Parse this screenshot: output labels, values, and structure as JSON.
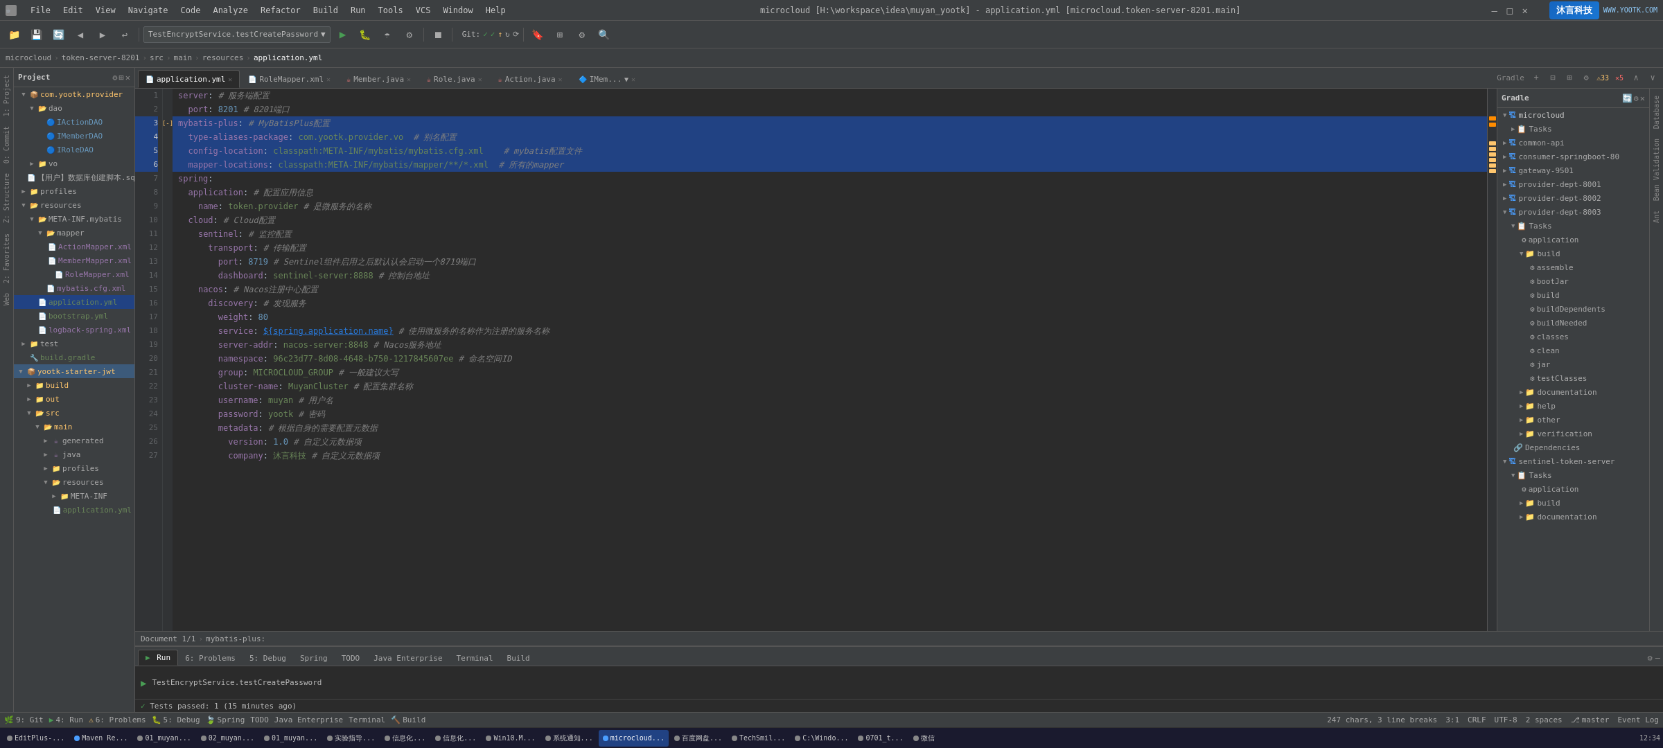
{
  "titlebar": {
    "icon": "☕",
    "menu_items": [
      "File",
      "Edit",
      "View",
      "Navigate",
      "Code",
      "Analyze",
      "Refactor",
      "Build",
      "Run",
      "Tools",
      "VCS",
      "Window",
      "Help"
    ],
    "title": "microcloud [H:\\workspace\\idea\\muyan_yootk] - application.yml [microcloud.token-server-8201.main]",
    "close": "✕",
    "minimize": "—",
    "maximize": "□"
  },
  "toolbar": {
    "combo_label": "TestEncryptService.testCreatePassword",
    "run": "▶",
    "debug": "🐛",
    "git_label": "Git:",
    "search_icon": "🔍"
  },
  "breadcrumb": {
    "items": [
      "microcloud",
      "token-server-8201",
      "src",
      "main",
      "resources",
      "application.yml"
    ]
  },
  "tabs": {
    "items": [
      {
        "id": "application-yml",
        "label": "application.yml",
        "active": true,
        "icon": "yml",
        "modified": false
      },
      {
        "id": "role-mapper-xml",
        "label": "RoleMapper.xml",
        "active": false,
        "icon": "xml"
      },
      {
        "id": "member-java",
        "label": "Member.java",
        "active": false,
        "icon": "java"
      },
      {
        "id": "role-java",
        "label": "Role.java",
        "active": false,
        "icon": "java"
      },
      {
        "id": "action-java",
        "label": "Action.java",
        "active": false,
        "icon": "java"
      },
      {
        "id": "imemb",
        "label": "IMem...",
        "active": false,
        "icon": "iface"
      }
    ],
    "more": "▼"
  },
  "editor": {
    "lines": [
      {
        "num": 1,
        "content": "server: # 服务端配置",
        "type": "normal"
      },
      {
        "num": 2,
        "content": "  port: 8201 # 8201端口",
        "type": "normal"
      },
      {
        "num": 3,
        "content": "mybatis-plus: # MyBatisPlus配置",
        "type": "highlight"
      },
      {
        "num": 4,
        "content": "  type-aliases-package: com.yootk.provider.vo  # 别名配置",
        "type": "highlight"
      },
      {
        "num": 5,
        "content": "  config-location: classpath:META-INF/mybatis/mybatis.cfg.xml    # mybatis配置文件",
        "type": "highlight"
      },
      {
        "num": 6,
        "content": "  mapper-locations: classpath:META-INF/mybatis/mapper/**/*.xml  # 所有的mapper",
        "type": "highlight"
      },
      {
        "num": 7,
        "content": "spring:",
        "type": "normal"
      },
      {
        "num": 8,
        "content": "  application: # 配置应用信息",
        "type": "normal"
      },
      {
        "num": 9,
        "content": "    name: token.provider # 是微服务的名称",
        "type": "normal"
      },
      {
        "num": 10,
        "content": "  cloud: # Cloud配置",
        "type": "normal"
      },
      {
        "num": 11,
        "content": "    sentinel: # 监控配置",
        "type": "normal"
      },
      {
        "num": 12,
        "content": "      transport: # 传输配置",
        "type": "normal"
      },
      {
        "num": 13,
        "content": "        port: 8719 # Sentinel组件启用之后默认认会启动一个8719端口",
        "type": "normal"
      },
      {
        "num": 14,
        "content": "        dashboard: sentinel-server:8888 # 控制台地址",
        "type": "normal"
      },
      {
        "num": 15,
        "content": "    nacos: # Nacos注册中心配置",
        "type": "normal"
      },
      {
        "num": 16,
        "content": "      discovery: # 发现服务",
        "type": "normal"
      },
      {
        "num": 17,
        "content": "        weight: 80",
        "type": "normal"
      },
      {
        "num": 18,
        "content": "        service: ${spring.application.name} # 使用微服务的名称作为注册的服务名称",
        "type": "normal"
      },
      {
        "num": 19,
        "content": "        server-addr: nacos-server:8848 # Nacos服务地址",
        "type": "normal"
      },
      {
        "num": 20,
        "content": "        namespace: 96c23d77-8d08-4648-b750-1217845607ee # 命名空间ID",
        "type": "normal"
      },
      {
        "num": 21,
        "content": "        group: MICROCLOUD_GROUP # 一般建议大写",
        "type": "normal"
      },
      {
        "num": 22,
        "content": "        cluster-name: MuyanCluster # 配置集群名称",
        "type": "normal"
      },
      {
        "num": 23,
        "content": "        username: muyan # 用户名",
        "type": "normal"
      },
      {
        "num": 24,
        "content": "        password: yootk # 密码",
        "type": "normal"
      },
      {
        "num": 25,
        "content": "        metadata: # 根据自身的需要配置元数据",
        "type": "normal"
      },
      {
        "num": 26,
        "content": "          version: 1.0 # 自定义元数据项",
        "type": "normal"
      },
      {
        "num": 27,
        "content": "          company: 沐言科技 # 自定义元数据项",
        "type": "normal"
      }
    ],
    "breadcrumb": {
      "doc": "Document 1/1",
      "path": "mybatis-plus:"
    }
  },
  "project_tree": {
    "header": "Project",
    "items": [
      {
        "level": 0,
        "label": "com.yootk.provider",
        "type": "package",
        "expanded": true
      },
      {
        "level": 1,
        "label": "dao",
        "type": "folder",
        "expanded": true
      },
      {
        "level": 2,
        "label": "IActionDAO",
        "type": "java"
      },
      {
        "level": 2,
        "label": "IMemberDAO",
        "type": "java"
      },
      {
        "level": 2,
        "label": "IRoleDAO",
        "type": "java"
      },
      {
        "level": 1,
        "label": "vo",
        "type": "folder",
        "expanded": false
      },
      {
        "level": 1,
        "label": "【用户】数据库创建脚本.sql",
        "type": "sql"
      },
      {
        "level": 0,
        "label": "profiles",
        "type": "folder",
        "expanded": false
      },
      {
        "level": 0,
        "label": "resources",
        "type": "folder",
        "expanded": true
      },
      {
        "level": 1,
        "label": "META-INF.mybatis",
        "type": "folder",
        "expanded": true
      },
      {
        "level": 2,
        "label": "mapper",
        "type": "folder",
        "expanded": true
      },
      {
        "level": 3,
        "label": "ActionMapper.xml",
        "type": "xml"
      },
      {
        "level": 3,
        "label": "MemberMapper.xml",
        "type": "xml"
      },
      {
        "level": 3,
        "label": "RoleMapper.xml",
        "type": "xml"
      },
      {
        "level": 2,
        "label": "mybatis.cfg.xml",
        "type": "xml"
      },
      {
        "level": 1,
        "label": "application.yml",
        "type": "yml",
        "selected": true
      },
      {
        "level": 1,
        "label": "bootstrap.yml",
        "type": "yml"
      },
      {
        "level": 1,
        "label": "logback-spring.xml",
        "type": "xml"
      },
      {
        "level": 0,
        "label": "test",
        "type": "folder",
        "expanded": false
      },
      {
        "level": 0,
        "label": "build.gradle",
        "type": "gradle"
      },
      {
        "level": -1,
        "label": "yootk-starter-jwt",
        "type": "module",
        "expanded": true
      },
      {
        "level": 0,
        "label": "build",
        "type": "folder",
        "expanded": false
      },
      {
        "level": 0,
        "label": "out",
        "type": "folder",
        "expanded": false
      },
      {
        "level": 0,
        "label": "src",
        "type": "folder",
        "expanded": true
      },
      {
        "level": 1,
        "label": "main",
        "type": "folder",
        "expanded": true
      },
      {
        "level": 2,
        "label": "java",
        "type": "folder",
        "expanded": false
      },
      {
        "level": 2,
        "label": "generated",
        "type": "folder",
        "expanded": false
      },
      {
        "level": 2,
        "label": "profiles",
        "type": "folder",
        "expanded": false
      },
      {
        "level": 2,
        "label": "resources",
        "type": "folder",
        "expanded": true
      },
      {
        "level": 3,
        "label": "META-INF",
        "type": "folder",
        "expanded": false
      },
      {
        "level": 3,
        "label": "application.yml",
        "type": "yml"
      }
    ]
  },
  "gradle_panel": {
    "header": "Gradle",
    "items": [
      {
        "level": 0,
        "label": "microcloud",
        "type": "project",
        "expanded": true
      },
      {
        "level": 1,
        "label": "Tasks",
        "type": "tasks",
        "expanded": false
      },
      {
        "level": 0,
        "label": "common-api",
        "type": "module",
        "expanded": false
      },
      {
        "level": 0,
        "label": "consumer-springboot-80",
        "type": "module",
        "expanded": false
      },
      {
        "level": 0,
        "label": "gateway-9501",
        "type": "module",
        "expanded": false
      },
      {
        "level": 0,
        "label": "provider-dept-8001",
        "type": "module",
        "expanded": false
      },
      {
        "level": 0,
        "label": "provider-dept-8002",
        "type": "module",
        "expanded": false
      },
      {
        "level": 0,
        "label": "provider-dept-8003",
        "type": "module",
        "expanded": true
      },
      {
        "level": 1,
        "label": "Tasks",
        "type": "tasks",
        "expanded": true
      },
      {
        "level": 2,
        "label": "application",
        "type": "task"
      },
      {
        "level": 2,
        "label": "build",
        "type": "folder",
        "expanded": true
      },
      {
        "level": 3,
        "label": "assemble",
        "type": "task"
      },
      {
        "level": 3,
        "label": "bootJar",
        "type": "task"
      },
      {
        "level": 3,
        "label": "build",
        "type": "task"
      },
      {
        "level": 3,
        "label": "buildDependents",
        "type": "task"
      },
      {
        "level": 3,
        "label": "buildNeeded",
        "type": "task"
      },
      {
        "level": 3,
        "label": "classes",
        "type": "task"
      },
      {
        "level": 3,
        "label": "clean",
        "type": "task"
      },
      {
        "level": 3,
        "label": "jar",
        "type": "task"
      },
      {
        "level": 3,
        "label": "testClasses",
        "type": "task"
      },
      {
        "level": 2,
        "label": "documentation",
        "type": "task"
      },
      {
        "level": 2,
        "label": "help",
        "type": "task"
      },
      {
        "level": 2,
        "label": "other",
        "type": "task"
      },
      {
        "level": 2,
        "label": "verification",
        "type": "task"
      },
      {
        "level": 1,
        "label": "Dependencies",
        "type": "deps"
      },
      {
        "level": 0,
        "label": "sentinel-token-server",
        "type": "module",
        "expanded": true
      },
      {
        "level": 1,
        "label": "Tasks",
        "type": "tasks",
        "expanded": true
      },
      {
        "level": 2,
        "label": "application",
        "type": "task"
      },
      {
        "level": 2,
        "label": "build",
        "type": "folder",
        "expanded": false
      },
      {
        "level": 2,
        "label": "documentation",
        "type": "task"
      }
    ]
  },
  "bottom_panel": {
    "tabs": [
      "Run",
      "6: Problems",
      "5: Debug",
      "Spring",
      "TODO",
      "Java Enterprise",
      "Terminal",
      "Build"
    ],
    "active_tab": "Run",
    "run_content": "TestEncryptService.testCreatePassword",
    "test_status": "Tests passed: 1 (15 minutes ago)"
  },
  "status_bar": {
    "git": "9: Git",
    "run": "4: Run",
    "problems": "6: Problems",
    "debug": "5: Debug",
    "spring": "Spring",
    "todo": "TODO",
    "java_ent": "Java Enterprise",
    "terminal": "Terminal",
    "build": "Build",
    "stats": "247 chars, 3 line breaks",
    "position": "3:1",
    "line_ending": "CRLF",
    "encoding": "UTF-8",
    "indent": "2 spaces",
    "branch": "master"
  },
  "taskbar": {
    "items": [
      {
        "label": "EditPlus-...",
        "color": "#888"
      },
      {
        "label": "Maven Re...",
        "color": "#4a9eff"
      },
      {
        "label": "01_muyan...",
        "color": "#888"
      },
      {
        "label": "02_muyan...",
        "color": "#888"
      },
      {
        "label": "01_muyan...",
        "color": "#888"
      },
      {
        "label": "实验指导...",
        "color": "#888"
      },
      {
        "label": "信息化...",
        "color": "#888"
      },
      {
        "label": "信息化...",
        "color": "#888"
      },
      {
        "label": "Win10.M...",
        "color": "#888"
      },
      {
        "label": "系统通知...",
        "color": "#888"
      },
      {
        "label": "microcloud...",
        "color": "#4a9eff",
        "active": true
      },
      {
        "label": "百度网盘...",
        "color": "#888"
      },
      {
        "label": "TechSmil...",
        "color": "#888"
      },
      {
        "label": "C:\\Windo...",
        "color": "#888"
      },
      {
        "label": "0701_t...",
        "color": "#888"
      },
      {
        "label": "微信",
        "color": "#888"
      }
    ]
  },
  "side_panels": {
    "left": [
      "1: Project",
      "0: Commit",
      "2: Favorites",
      "Z: Structure"
    ],
    "right": [
      "Gradle",
      "Database",
      "Bean Validation",
      "Ant"
    ]
  },
  "warnings": {
    "count": "33",
    "errors": "5"
  },
  "logo": {
    "company": "沐言科技",
    "url": "WWW.YOOTK.COM"
  }
}
